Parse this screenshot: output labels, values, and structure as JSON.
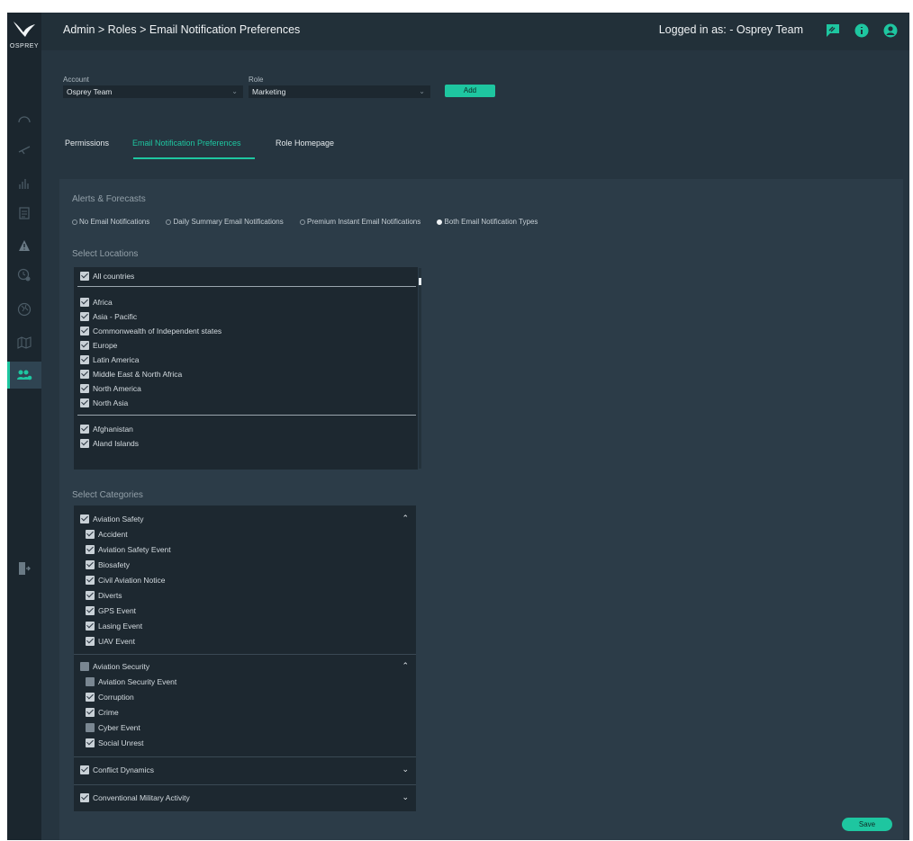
{
  "brand": {
    "name": "OSPREY",
    "accent": "#1ec6a0"
  },
  "header": {
    "breadcrumb": "Admin > Roles > Email Notification Preferences",
    "logged_in": "Logged in as:  - Osprey Team",
    "icons": [
      "feedback-icon",
      "info-icon",
      "user-icon"
    ]
  },
  "sidebar": {
    "icons": [
      "dashboard-icon",
      "flights-icon",
      "analytics-icon",
      "reports-icon",
      "alert-icon",
      "clock-settings-icon",
      "globe-icon",
      "map-icon",
      "users-icon",
      "logout-icon"
    ]
  },
  "form": {
    "account_label": "Account",
    "account_value": "Osprey Team",
    "role_label": "Role",
    "role_value": "Marketing",
    "add_label": "Add"
  },
  "tabs": [
    {
      "label": "Permissions"
    },
    {
      "label": "Email Notification Preferences",
      "active": true
    },
    {
      "label": "Role Homepage"
    }
  ],
  "alerts": {
    "title": "Alerts & Forecasts",
    "options": [
      {
        "label": "No Email Notifications",
        "selected": false
      },
      {
        "label": "Daily Summary Email Notifications",
        "selected": false
      },
      {
        "label": "Premium Instant Email Notifications",
        "selected": false
      },
      {
        "label": "Both Email Notification Types",
        "selected": true
      }
    ]
  },
  "locations": {
    "title": "Select Locations",
    "all_label": "All countries",
    "regions": [
      "Africa",
      "Asia - Pacific",
      "Commonwealth of Independent states",
      "Europe",
      "Latin America",
      "Middle East & North Africa",
      "North America",
      "North Asia"
    ],
    "countries": [
      "Afghanistan",
      "Aland Islands"
    ]
  },
  "categories": {
    "title": "Select Categories",
    "groups": [
      {
        "label": "Aviation Safety",
        "checked": true,
        "expanded": true,
        "items": [
          {
            "label": "Accident",
            "checked": true
          },
          {
            "label": "Aviation Safety Event",
            "checked": true
          },
          {
            "label": "Biosafety",
            "checked": true
          },
          {
            "label": "Civil Aviation Notice",
            "checked": true
          },
          {
            "label": "Diverts",
            "checked": true
          },
          {
            "label": "GPS Event",
            "checked": true
          },
          {
            "label": "Lasing Event",
            "checked": true
          },
          {
            "label": "UAV Event",
            "checked": true
          }
        ]
      },
      {
        "label": "Aviation Security",
        "checked": false,
        "expanded": true,
        "items": [
          {
            "label": "Aviation Security Event",
            "checked": false
          },
          {
            "label": "Corruption",
            "checked": true
          },
          {
            "label": "Crime",
            "checked": true
          },
          {
            "label": "Cyber Event",
            "checked": false
          },
          {
            "label": "Social Unrest",
            "checked": true
          }
        ]
      },
      {
        "label": "Conflict Dynamics",
        "checked": true,
        "expanded": false,
        "items": []
      },
      {
        "label": "Conventional Military Activity",
        "checked": true,
        "expanded": false,
        "items": []
      }
    ]
  },
  "save_label": "Save"
}
